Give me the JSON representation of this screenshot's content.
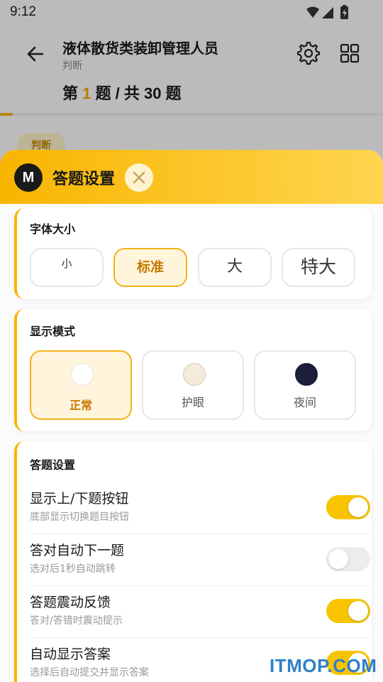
{
  "status": {
    "time": "9:12"
  },
  "appbar": {
    "title": "液体散货类装卸管理人员",
    "subtitle": "判断",
    "q_prefix": "第",
    "q_current": "1",
    "q_suffix": "题 / 共 30 题",
    "progress": 0.033
  },
  "question": {
    "tag": "判断"
  },
  "sheet": {
    "logo": "M",
    "title": "答题设置",
    "font_section": {
      "title": "字体大小",
      "options": [
        "小",
        "标准",
        "大",
        "特大"
      ],
      "selected": "标准"
    },
    "mode_section": {
      "title": "显示模式",
      "options": [
        {
          "label": "正常",
          "color": "#ffffff"
        },
        {
          "label": "护眼",
          "color": "#f3ecdc"
        },
        {
          "label": "夜间",
          "color": "#1c1f3a"
        }
      ],
      "selected": "正常"
    },
    "answer_section": {
      "title": "答题设置",
      "rows": [
        {
          "title": "显示上/下题按钮",
          "subtitle": "底部显示切换题目按钮",
          "on": true
        },
        {
          "title": "答对自动下一题",
          "subtitle": "选对后1秒自动跳转",
          "on": false
        },
        {
          "title": "答题震动反馈",
          "subtitle": "答对/答错时震动提示",
          "on": true
        },
        {
          "title": "自动显示答案",
          "subtitle": "选择后自动提交并显示答案",
          "on": true
        }
      ]
    }
  },
  "watermark": "ITMOP.COM",
  "colors": {
    "accent": "#f8b500",
    "toggle_on": "#f8c400",
    "selected_text": "#c77800"
  }
}
